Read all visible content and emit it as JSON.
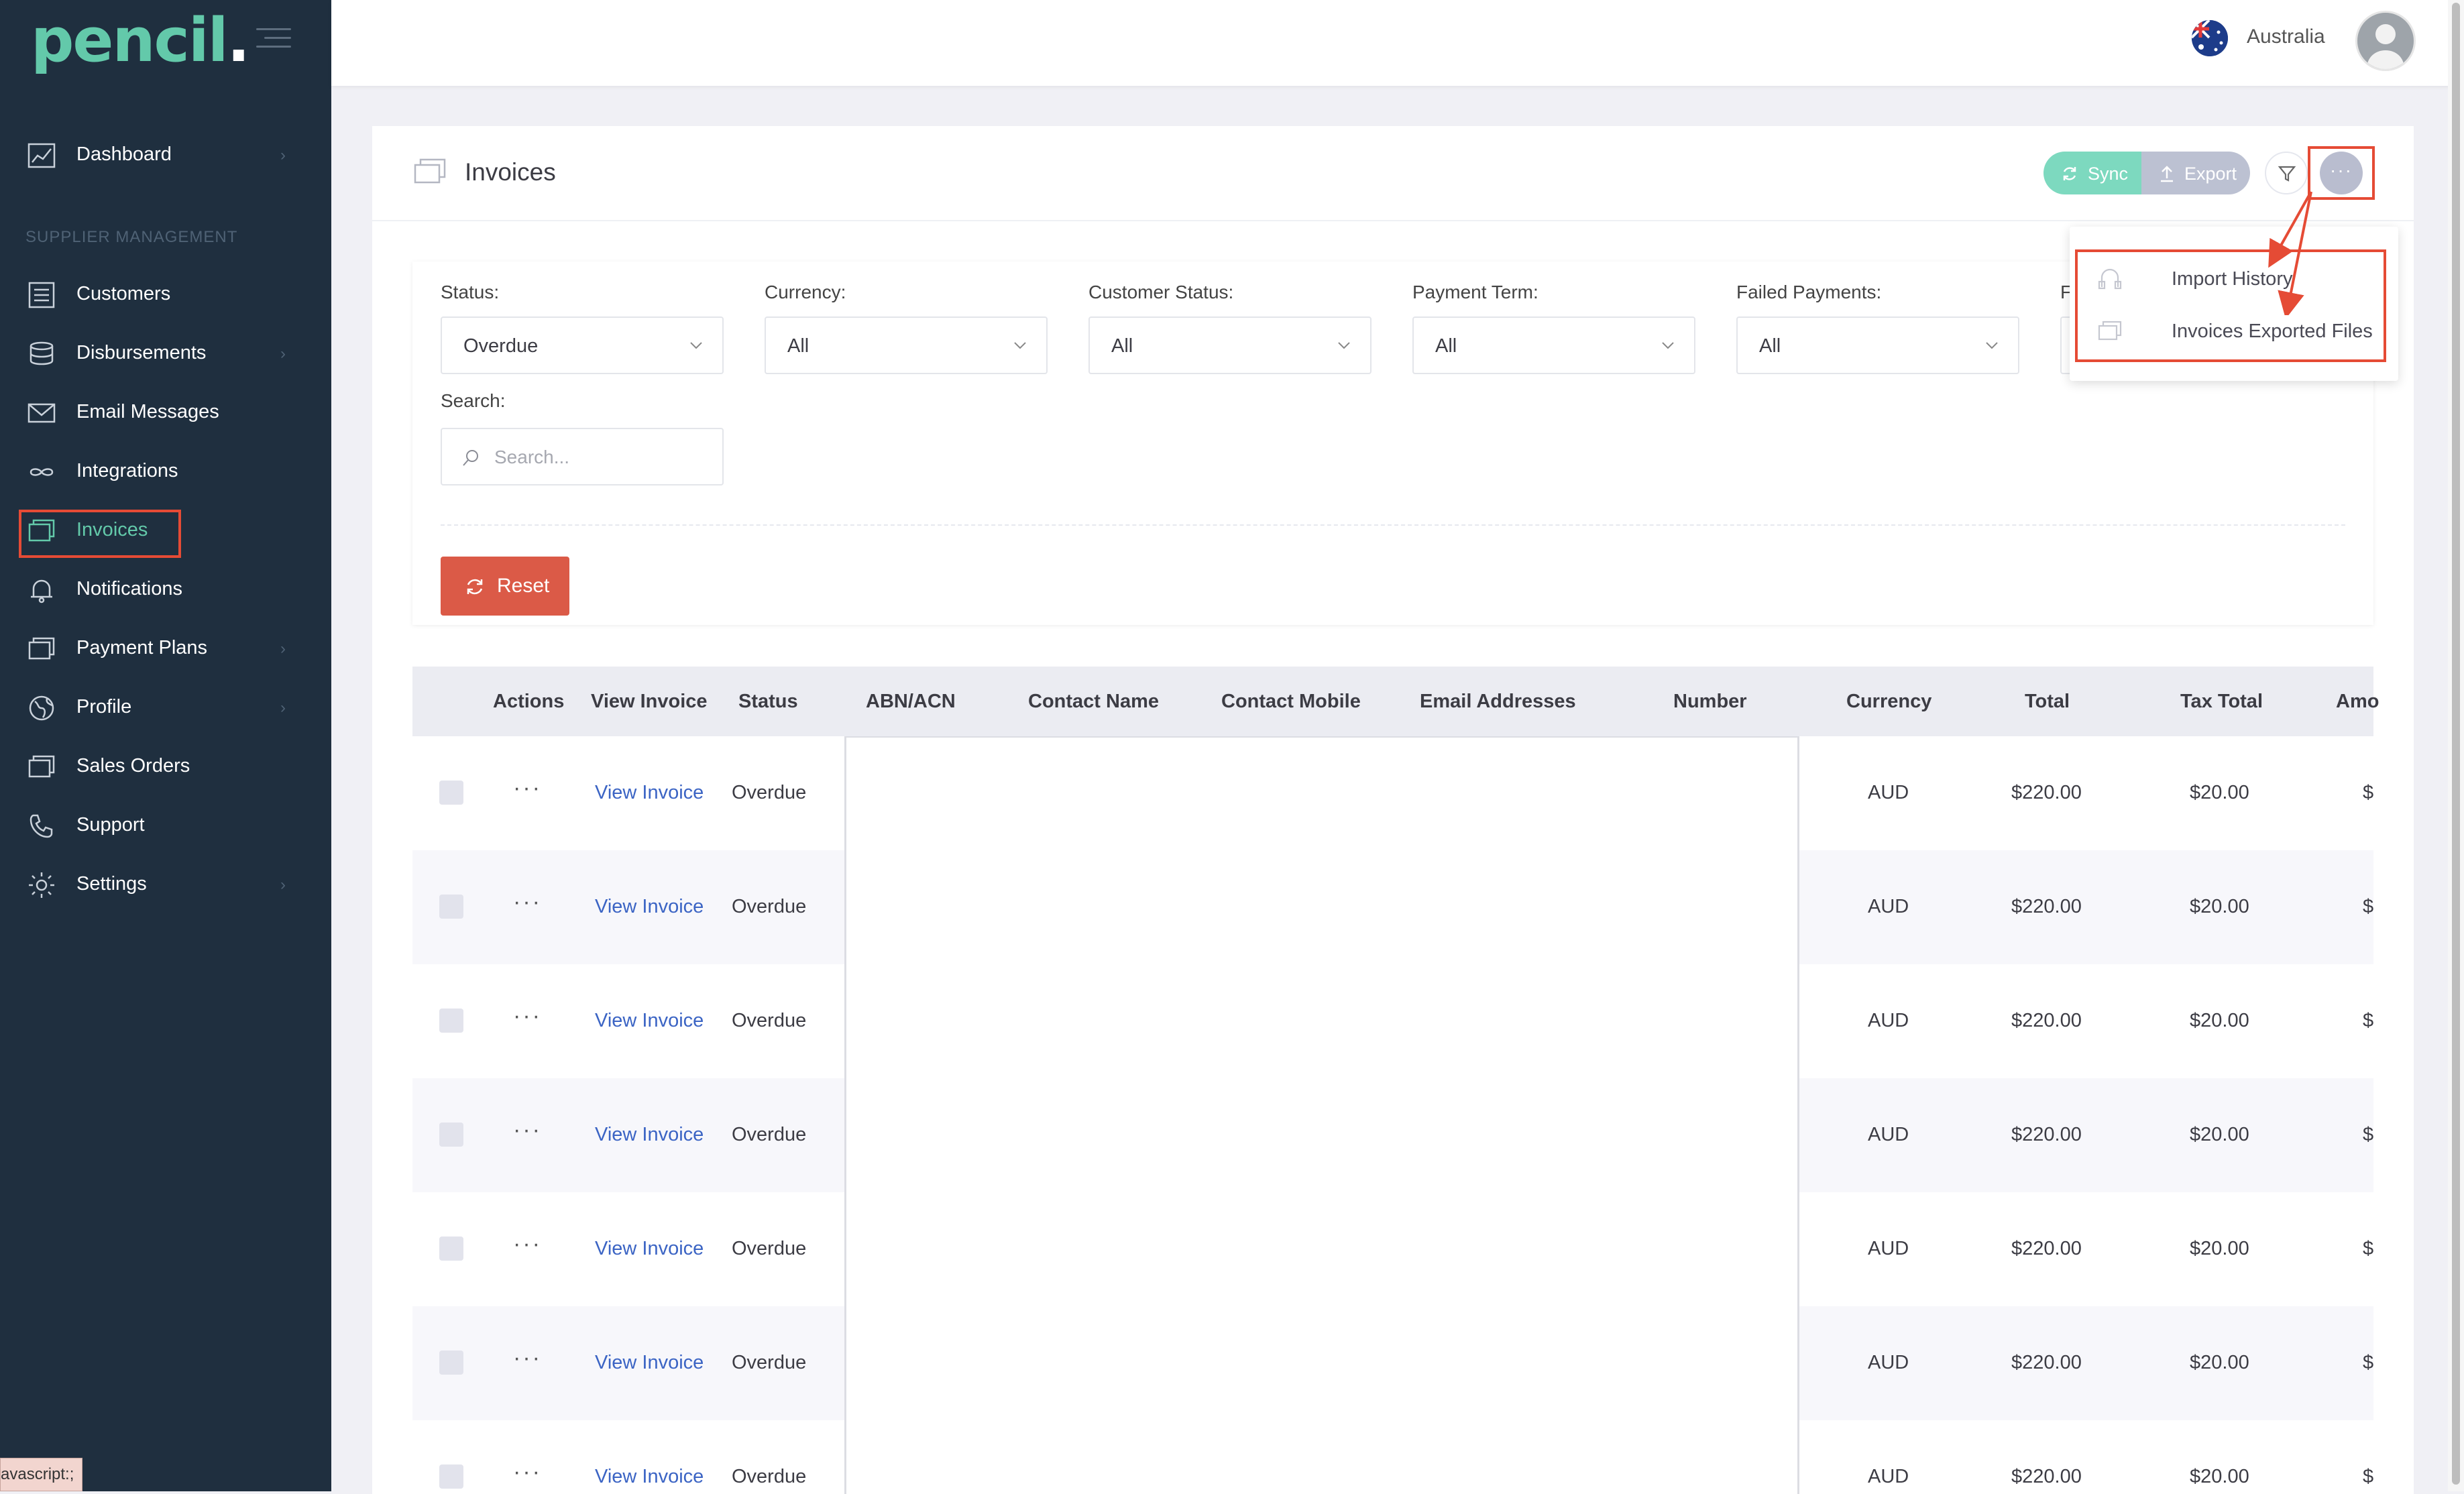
{
  "app": {
    "logo_text": "pencil",
    "logo_dot": "."
  },
  "sidebar": {
    "section_title": "SUPPLIER MANAGEMENT",
    "items": [
      {
        "label": "Dashboard",
        "has_chevron": true
      },
      {
        "label": "Customers",
        "has_chevron": false
      },
      {
        "label": "Disbursements",
        "has_chevron": true
      },
      {
        "label": "Email Messages",
        "has_chevron": false
      },
      {
        "label": "Integrations",
        "has_chevron": false
      },
      {
        "label": "Invoices",
        "has_chevron": false,
        "active": true
      },
      {
        "label": "Notifications",
        "has_chevron": false
      },
      {
        "label": "Payment Plans",
        "has_chevron": true
      },
      {
        "label": "Profile",
        "has_chevron": true
      },
      {
        "label": "Sales Orders",
        "has_chevron": false
      },
      {
        "label": "Support",
        "has_chevron": false
      },
      {
        "label": "Settings",
        "has_chevron": true
      }
    ],
    "chevron": "›"
  },
  "status_bar": {
    "url": "avascript:;"
  },
  "topbar": {
    "country": "Australia"
  },
  "page": {
    "title": "Invoices",
    "sync_label": "Sync",
    "export_label": "Export",
    "more_label": "···"
  },
  "filters": {
    "status": {
      "label": "Status:",
      "value": "Overdue"
    },
    "currency": {
      "label": "Currency:",
      "value": "All"
    },
    "customer_status": {
      "label": "Customer Status:",
      "value": "All"
    },
    "payment_term": {
      "label": "Payment Term:",
      "value": "All"
    },
    "failed_payments": {
      "label": "Failed Payments:",
      "value": "All"
    },
    "partial_label": "F",
    "search": {
      "label": "Search:",
      "placeholder": "Search..."
    },
    "reset_label": "Reset"
  },
  "dropdown": {
    "items": [
      {
        "label": "Import History",
        "icon": "import-history-icon"
      },
      {
        "label": "Invoices Exported Files",
        "icon": "exported-files-icon"
      }
    ]
  },
  "table": {
    "columns": [
      "Actions",
      "View Invoice",
      "Status",
      "ABN/ACN",
      "Contact Name",
      "Contact Mobile",
      "Email Addresses",
      "Number",
      "Currency",
      "Total",
      "Tax Total",
      "Amo"
    ],
    "rows": [
      {
        "actions": "···",
        "link": "View Invoice",
        "status": "Overdue",
        "currency": "AUD",
        "total": "$220.00",
        "tax_total": "$20.00",
        "amount": "$"
      },
      {
        "actions": "···",
        "link": "View Invoice",
        "status": "Overdue",
        "currency": "AUD",
        "total": "$220.00",
        "tax_total": "$20.00",
        "amount": "$"
      },
      {
        "actions": "···",
        "link": "View Invoice",
        "status": "Overdue",
        "currency": "AUD",
        "total": "$220.00",
        "tax_total": "$20.00",
        "amount": "$"
      },
      {
        "actions": "···",
        "link": "View Invoice",
        "status": "Overdue",
        "currency": "AUD",
        "total": "$220.00",
        "tax_total": "$20.00",
        "amount": "$"
      },
      {
        "actions": "···",
        "link": "View Invoice",
        "status": "Overdue",
        "currency": "AUD",
        "total": "$220.00",
        "tax_total": "$20.00",
        "amount": "$"
      },
      {
        "actions": "···",
        "link": "View Invoice",
        "status": "Overdue",
        "currency": "AUD",
        "total": "$220.00",
        "tax_total": "$20.00",
        "amount": "$"
      },
      {
        "actions": "···",
        "link": "View Invoice",
        "status": "Overdue",
        "currency": "AUD",
        "total": "$220.00",
        "tax_total": "$20.00",
        "amount": "$"
      }
    ]
  },
  "colors": {
    "sidebar_bg": "#1f2f3f",
    "accent": "#63c9aa",
    "highlight": "#e54b35",
    "reset": "#db5a47",
    "link": "#3b64c4"
  }
}
